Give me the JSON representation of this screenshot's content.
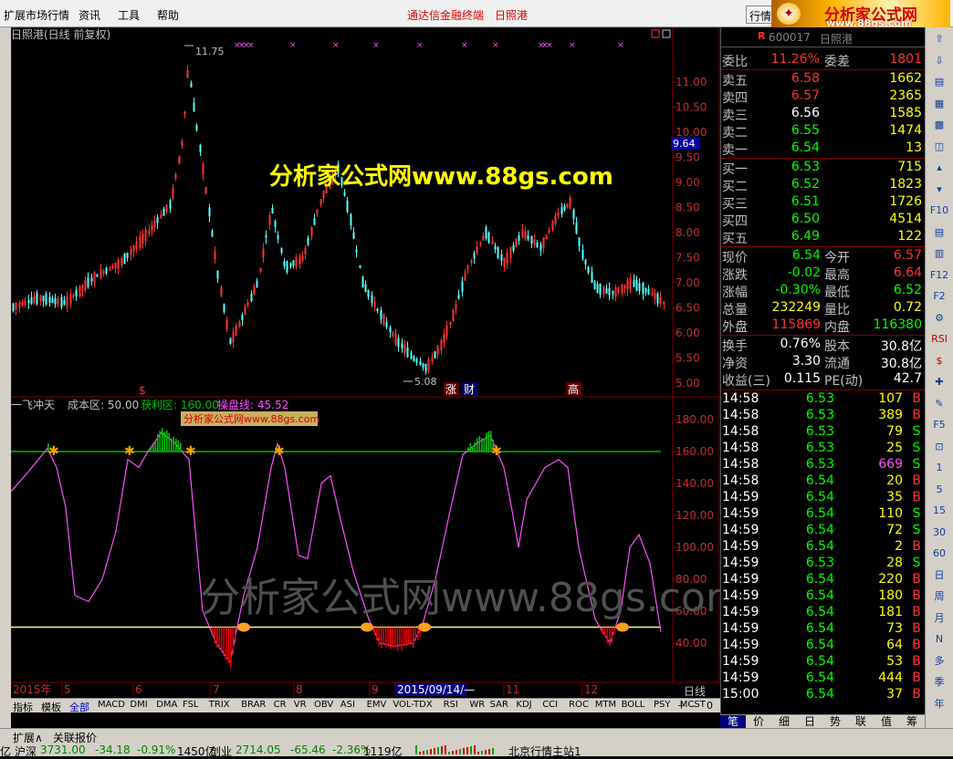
{
  "menubar": {
    "items": [
      "扩展市场行情",
      "资讯",
      "工具",
      "帮助"
    ],
    "title_left": "通达信金融终端",
    "title_right": "日照港",
    "market_button": "行情",
    "logo_text": "分析家公式网",
    "logo_url": "www.88gs.com"
  },
  "chart": {
    "header": "日照港(日线 前复权)",
    "price_high_label": "11.75",
    "price_low_label": "5.08",
    "current_price_tag": "9.64",
    "price_axis": [
      "11.00",
      "10.50",
      "10.00",
      "9.50",
      "9.00",
      "8.50",
      "8.00",
      "7.50",
      "7.00",
      "6.50",
      "6.00",
      "5.50",
      "5.00"
    ],
    "watermark_main": "分析家公式网www.88gs.com",
    "watermark_lower": "分析家公式网www.88gs.com",
    "event_marks": [
      "$",
      "涨",
      "财",
      "高"
    ],
    "indicator_name": "一飞冲天",
    "indicator_cost_label": "成本区: 50.00",
    "indicator_profit_label": "获利区: 160.00",
    "indicator_op_label": "操盘线: 45.52",
    "indicator_tag": "分析家公式网www.88gs.com",
    "indicator_axis": [
      "180.00",
      "160.00",
      "140.00",
      "120.00",
      "100.00",
      "80.00",
      "60.00",
      "40.00"
    ],
    "dates": [
      "2015年",
      "5",
      "6",
      "7",
      "8",
      "9",
      "2015/09/14/—",
      "11",
      "12"
    ],
    "period_label": "日线",
    "colors": {
      "up": "#ff3232",
      "down": "#54ffff",
      "line": "#ff50ff",
      "profit": "#00c000",
      "cost": "#ffff60",
      "grid": "#800000"
    }
  },
  "indicator_tabs": {
    "left_tabs": [
      "指标",
      "模板",
      "全部"
    ],
    "items": [
      "MACD",
      "DMI",
      "DMA",
      "FSL",
      "TRIX",
      "BRAR",
      "CR",
      "VR",
      "OBV",
      "ASI",
      "EMV",
      "VOL-TDX",
      "RSI",
      "WR",
      "SAR",
      "KDJ",
      "CCI",
      "ROC",
      "MTM",
      "BOLL",
      "PSY",
      "MCST"
    ],
    "controls": [
      "+",
      "-",
      "0"
    ],
    "sub_tabs": [
      "扩展∧",
      "关联报价"
    ]
  },
  "quote": {
    "header": {
      "r_label": "R",
      "code": "600017",
      "name": "日照港"
    },
    "weibi": {
      "label": "委比",
      "value": "11.26%",
      "label2": "委差",
      "value2": "1801"
    },
    "sell": [
      {
        "label": "卖五",
        "price": "6.58",
        "vol": "1662"
      },
      {
        "label": "卖四",
        "price": "6.57",
        "vol": "2365"
      },
      {
        "label": "卖三",
        "price": "6.56",
        "vol": "1585"
      },
      {
        "label": "卖二",
        "price": "6.55",
        "vol": "1474"
      },
      {
        "label": "卖一",
        "price": "6.54",
        "vol": "13"
      }
    ],
    "buy": [
      {
        "label": "买一",
        "price": "6.53",
        "vol": "715"
      },
      {
        "label": "买二",
        "price": "6.52",
        "vol": "1823"
      },
      {
        "label": "买三",
        "price": "6.51",
        "vol": "1726"
      },
      {
        "label": "买四",
        "price": "6.50",
        "vol": "4514"
      },
      {
        "label": "买五",
        "price": "6.49",
        "vol": "122"
      }
    ],
    "stats": [
      {
        "l1": "现价",
        "v1": "6.54",
        "l2": "今开",
        "v2": "6.57",
        "c1": "#00ff00",
        "c2": "#ff3232"
      },
      {
        "l1": "涨跌",
        "v1": "-0.02",
        "l2": "最高",
        "v2": "6.64",
        "c1": "#00ff00",
        "c2": "#ff3232"
      },
      {
        "l1": "涨幅",
        "v1": "-0.30%",
        "l2": "最低",
        "v2": "6.52",
        "c1": "#00ff00",
        "c2": "#00ff00"
      },
      {
        "l1": "总量",
        "v1": "232249",
        "l2": "量比",
        "v2": "0.72",
        "c1": "#ffff00",
        "c2": "#ffff00"
      },
      {
        "l1": "外盘",
        "v1": "115869",
        "l2": "内盘",
        "v2": "116380",
        "c1": "#ff3232",
        "c2": "#00ff00"
      }
    ],
    "fundamentals": [
      {
        "l1": "换手",
        "v1": "0.76%",
        "l2": "股本",
        "v2": "30.8亿"
      },
      {
        "l1": "净资",
        "v1": "3.30",
        "l2": "流通",
        "v2": "30.8亿"
      },
      {
        "l1": "收益(三)",
        "v1": "0.115",
        "l2": "PE(动)",
        "v2": "42.7"
      }
    ],
    "ticks": [
      {
        "t": "14:58",
        "p": "6.53",
        "v": "107",
        "s": "B"
      },
      {
        "t": "14:58",
        "p": "6.53",
        "v": "389",
        "s": "B"
      },
      {
        "t": "14:58",
        "p": "6.53",
        "v": "79",
        "s": "S"
      },
      {
        "t": "14:58",
        "p": "6.53",
        "v": "25",
        "s": "S"
      },
      {
        "t": "14:58",
        "p": "6.53",
        "v": "669",
        "s": "S"
      },
      {
        "t": "14:58",
        "p": "6.54",
        "v": "20",
        "s": "B"
      },
      {
        "t": "14:59",
        "p": "6.54",
        "v": "35",
        "s": "B"
      },
      {
        "t": "14:59",
        "p": "6.54",
        "v": "110",
        "s": "S"
      },
      {
        "t": "14:59",
        "p": "6.54",
        "v": "72",
        "s": "S"
      },
      {
        "t": "14:59",
        "p": "6.54",
        "v": "2",
        "s": "B"
      },
      {
        "t": "14:59",
        "p": "6.53",
        "v": "28",
        "s": "S"
      },
      {
        "t": "14:59",
        "p": "6.54",
        "v": "220",
        "s": "B"
      },
      {
        "t": "14:59",
        "p": "6.54",
        "v": "180",
        "s": "B"
      },
      {
        "t": "14:59",
        "p": "6.54",
        "v": "181",
        "s": "B"
      },
      {
        "t": "14:59",
        "p": "6.54",
        "v": "73",
        "s": "B"
      },
      {
        "t": "14:59",
        "p": "6.54",
        "v": "64",
        "s": "B"
      },
      {
        "t": "14:59",
        "p": "6.54",
        "v": "53",
        "s": "B"
      },
      {
        "t": "14:59",
        "p": "6.54",
        "v": "444",
        "s": "B"
      },
      {
        "t": "15:00",
        "p": "6.54",
        "v": "37",
        "s": "B"
      }
    ],
    "bottom_tabs": [
      "笔",
      "价",
      "细",
      "日",
      "势",
      "联",
      "值",
      "筹"
    ]
  },
  "toolbar": {
    "items": [
      "⇧",
      "⇩",
      "▤",
      "▦",
      "▩",
      "◫",
      "▴",
      "▾",
      "F10",
      "▤",
      "▥",
      "F12",
      "F2",
      "⚙",
      "RSI",
      "$",
      "✚",
      "✎",
      "F5",
      "⊡",
      "1",
      "5",
      "15",
      "30",
      "60",
      "日",
      "周",
      "月",
      "N",
      "多",
      "季",
      "年"
    ]
  },
  "status": {
    "items": [
      {
        "text": "亿",
        "color": "#000"
      },
      {
        "text": "沪深",
        "color": "#000"
      },
      {
        "text": "3731.00",
        "color": "#008000"
      },
      {
        "text": "-34.18",
        "color": "#008000"
      },
      {
        "text": "-0.91%",
        "color": "#008000"
      },
      {
        "text": "1450亿",
        "color": "#000"
      },
      {
        "text": "创业",
        "color": "#000"
      },
      {
        "text": "2714.05",
        "color": "#008000"
      },
      {
        "text": "-65.46",
        "color": "#008000"
      },
      {
        "text": "-2.36%",
        "color": "#008000"
      },
      {
        "text": "1119亿",
        "color": "#000"
      },
      {
        "text": "北京行情主站1",
        "color": "#000"
      }
    ]
  }
}
